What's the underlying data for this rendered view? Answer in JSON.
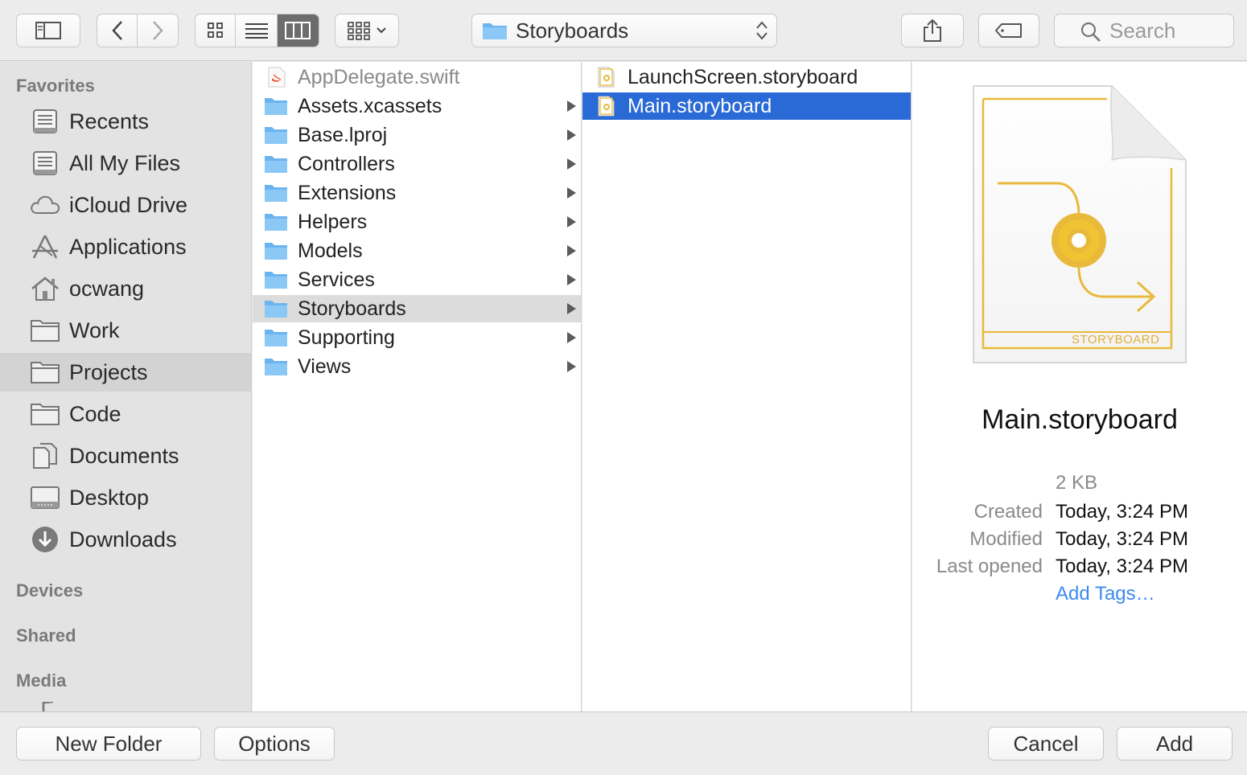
{
  "toolbar": {
    "path_popup_label": "Storyboards",
    "search_placeholder": "Search"
  },
  "sidebar": {
    "sections": {
      "favorites": "Favorites",
      "devices": "Devices",
      "shared": "Shared",
      "media": "Media"
    },
    "items": [
      {
        "label": "Recents",
        "icon": "recents-icon"
      },
      {
        "label": "All My Files",
        "icon": "all-files-icon"
      },
      {
        "label": "iCloud Drive",
        "icon": "cloud-icon"
      },
      {
        "label": "Applications",
        "icon": "applications-icon"
      },
      {
        "label": "ocwang",
        "icon": "home-icon"
      },
      {
        "label": "Work",
        "icon": "folder-icon"
      },
      {
        "label": "Projects",
        "icon": "folder-icon",
        "selected": true
      },
      {
        "label": "Code",
        "icon": "folder-icon"
      },
      {
        "label": "Documents",
        "icon": "documents-icon"
      },
      {
        "label": "Desktop",
        "icon": "desktop-icon"
      },
      {
        "label": "Downloads",
        "icon": "downloads-icon"
      }
    ]
  },
  "column1": [
    {
      "name": "AppDelegate.swift",
      "type": "swift-file",
      "dim": true
    },
    {
      "name": "Assets.xcassets",
      "type": "folder"
    },
    {
      "name": "Base.lproj",
      "type": "folder"
    },
    {
      "name": "Controllers",
      "type": "folder"
    },
    {
      "name": "Extensions",
      "type": "folder"
    },
    {
      "name": "Helpers",
      "type": "folder"
    },
    {
      "name": "Models",
      "type": "folder"
    },
    {
      "name": "Services",
      "type": "folder"
    },
    {
      "name": "Storyboards",
      "type": "folder",
      "selected": true
    },
    {
      "name": "Supporting",
      "type": "folder"
    },
    {
      "name": "Views",
      "type": "folder"
    }
  ],
  "column2": [
    {
      "name": "LaunchScreen.storyboard",
      "type": "storyboard-file"
    },
    {
      "name": "Main.storyboard",
      "type": "storyboard-file",
      "selected": true
    }
  ],
  "preview": {
    "badge": "STORYBOARD",
    "file_name": "Main.storyboard",
    "size": "2 KB",
    "created_label": "Created",
    "created_value": "Today, 3:24 PM",
    "modified_label": "Modified",
    "modified_value": "Today, 3:24 PM",
    "opened_label": "Last opened",
    "opened_value": "Today, 3:24 PM",
    "add_tags": "Add Tags…"
  },
  "buttons": {
    "new_folder": "New Folder",
    "options": "Options",
    "cancel": "Cancel",
    "add": "Add"
  },
  "colors": {
    "selection_blue": "#2a6ad6",
    "folder_blue": "#6bb4ef",
    "storyboard_gold": "#e8b93a",
    "link_blue": "#3c8af0"
  }
}
